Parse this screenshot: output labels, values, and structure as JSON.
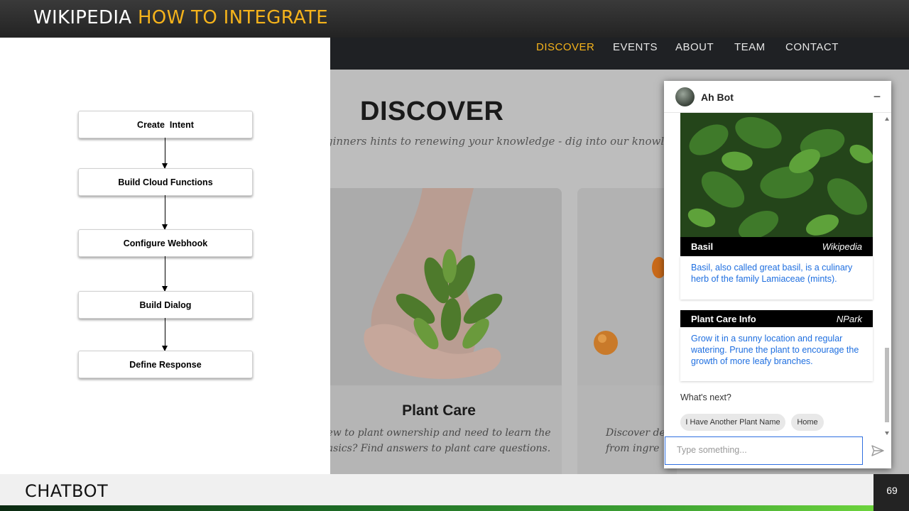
{
  "slide": {
    "title_part1": "WIKIPEDIA",
    "title_part2": "HOW TO INTEGRATE",
    "footer_label": "CHATBOT",
    "page_number": "69",
    "accent_color": "#f5b31b"
  },
  "flow": {
    "steps": [
      "Create  Intent",
      "Build Cloud Functions",
      "Configure Webhook",
      "Build Dialog",
      "Define Response"
    ]
  },
  "website": {
    "nav": [
      "DISCOVER",
      "EVENTS",
      "ABOUT",
      "TEAM",
      "CONTACT"
    ],
    "active_nav": "DISCOVER",
    "heading": "DISCOVER",
    "subheading": "ginners hints to renewing your knowledge - dig into our knowledge.",
    "card1": {
      "title": "Plant Care",
      "desc": "ew to plant ownership and need to learn the\nasics? Find answers to plant care questions."
    },
    "card2": {
      "desc": "Discover del\nfrom ingre"
    }
  },
  "chatbot": {
    "bot_name": "Ah Bot",
    "minimize_icon": "minus-icon",
    "basil_card": {
      "title": "Basil",
      "source": "Wikipedia",
      "text": "Basil, also called great basil, is a culinary herb of the family Lamiaceae (mints)."
    },
    "care_card": {
      "title": "Plant Care Info",
      "source": "NPark",
      "text": "Grow it in a sunny location and regular watering. Prune the plant to encourage the growth of more leafy branches."
    },
    "prompt": "What's next?",
    "chips": [
      "I Have Another Plant Name",
      "Home"
    ],
    "input_placeholder": "Type something...",
    "link_color": "#1f6fe0"
  }
}
